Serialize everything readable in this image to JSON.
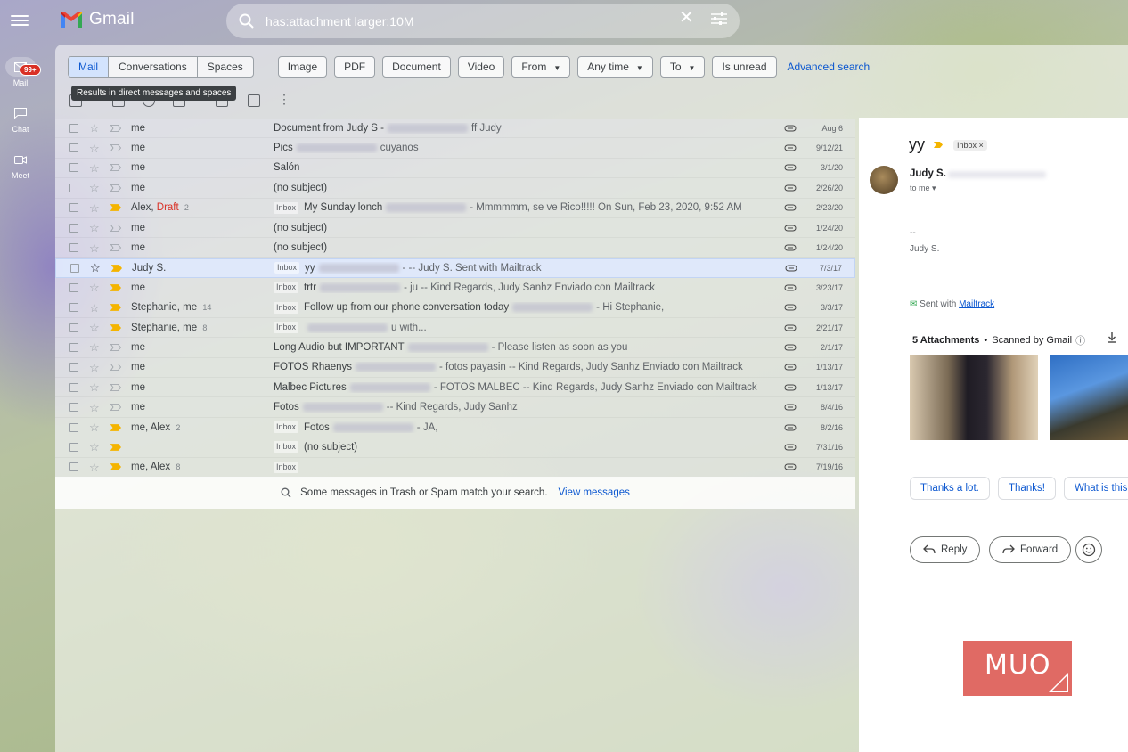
{
  "app": {
    "name": "Gmail"
  },
  "search": {
    "value": "has:attachment larger:10M"
  },
  "rail": {
    "mail_label": "Mail",
    "mail_badge": "99+",
    "chat_label": "Chat",
    "meet_label": "Meet"
  },
  "filters": {
    "scope": [
      "Mail",
      "Conversations",
      "Spaces"
    ],
    "tooltip": "Results in direct messages and spaces",
    "chips": {
      "image": "Image",
      "pdf": "PDF",
      "document": "Document",
      "video": "Video",
      "from": "From",
      "any_time": "Any time",
      "to": "To",
      "is_unread": "Is unread"
    },
    "advanced": "Advanced search"
  },
  "emails": [
    {
      "sender": "me",
      "draft": "",
      "count": "",
      "label": "",
      "subject": "Document from Judy S -",
      "snippet": "ff Judy",
      "date": "Aug 6"
    },
    {
      "sender": "me",
      "draft": "",
      "count": "",
      "label": "",
      "subject": "Pics",
      "snippet": "cuyanos",
      "date": "9/12/21"
    },
    {
      "sender": "me",
      "draft": "",
      "count": "",
      "label": "",
      "subject": "Salón",
      "snippet": "",
      "date": "3/1/20"
    },
    {
      "sender": "me",
      "draft": "",
      "count": "",
      "label": "",
      "subject": "(no subject)",
      "snippet": "",
      "date": "2/26/20"
    },
    {
      "sender": "Alex,",
      "draft": "Draft",
      "count": "2",
      "label": "Inbox",
      "subject": "My Sunday lonch",
      "snippet": "- Mmmmmm, se ve Rico!!!!! On Sun, Feb 23, 2020, 9:52 AM",
      "date": "2/23/20"
    },
    {
      "sender": "me",
      "draft": "",
      "count": "",
      "label": "",
      "subject": "(no subject)",
      "snippet": "",
      "date": "1/24/20"
    },
    {
      "sender": "me",
      "draft": "",
      "count": "",
      "label": "",
      "subject": "(no subject)",
      "snippet": "",
      "date": "1/24/20"
    },
    {
      "sender": "Judy S.",
      "draft": "",
      "count": "",
      "label": "Inbox",
      "subject": "yy",
      "snippet": "- -- Judy S. Sent with Mailtrack",
      "date": "7/3/17"
    },
    {
      "sender": "me",
      "draft": "",
      "count": "",
      "label": "Inbox",
      "subject": "trtr",
      "snippet": "- ju -- Kind Regards, Judy Sanhz Enviado con Mailtrack",
      "date": "3/23/17"
    },
    {
      "sender": "Stephanie, me",
      "draft": "",
      "count": "14",
      "label": "Inbox",
      "subject": "Follow up from our phone conversation today",
      "snippet": "- Hi Stephanie,",
      "date": "3/3/17"
    },
    {
      "sender": "Stephanie, me",
      "draft": "",
      "count": "8",
      "label": "Inbox",
      "subject": "",
      "snippet": "u with...",
      "date": "2/21/17"
    },
    {
      "sender": "me",
      "draft": "",
      "count": "",
      "label": "",
      "subject": "Long Audio but IMPORTANT",
      "snippet": "- Please listen as soon as you",
      "date": "2/1/17"
    },
    {
      "sender": "me",
      "draft": "",
      "count": "",
      "label": "",
      "subject": "FOTOS Rhaenys",
      "snippet": "- fotos payasin -- Kind Regards, Judy Sanhz Enviado con Mailtrack",
      "date": "1/13/17"
    },
    {
      "sender": "me",
      "draft": "",
      "count": "",
      "label": "",
      "subject": "Malbec Pictures",
      "snippet": "- FOTOS MALBEC -- Kind Regards, Judy Sanhz Enviado con Mailtrack",
      "date": "1/13/17"
    },
    {
      "sender": "me",
      "draft": "",
      "count": "",
      "label": "",
      "subject": "Fotos",
      "snippet": "-- Kind Regards, Judy Sanhz",
      "date": "8/4/16"
    },
    {
      "sender": "me, Alex",
      "draft": "",
      "count": "2",
      "label": "Inbox",
      "subject": "Fotos",
      "snippet": "- JA,",
      "date": "8/2/16"
    },
    {
      "sender": "",
      "draft": "",
      "count": "",
      "label": "Inbox",
      "subject": "(no subject)",
      "snippet": "",
      "date": "7/31/16"
    },
    {
      "sender": "me, Alex",
      "draft": "",
      "count": "8",
      "label": "Inbox",
      "subject": "",
      "snippet": "",
      "date": "7/19/16"
    }
  ],
  "trash_note": {
    "text": "Some messages in Trash or Spam match your search.",
    "link": "View messages"
  },
  "reading_pane": {
    "subject": "yy",
    "label": "Inbox",
    "from_name": "Judy S.",
    "to": "to me",
    "body_dash": "--",
    "body_signature": "Judy S.",
    "sent_with": "Sent with",
    "mailtrack": "Mailtrack",
    "attachments_count": "5 Attachments",
    "scanned": "Scanned by Gmail",
    "smart_replies": [
      "Thanks a lot.",
      "Thanks!",
      "What is this"
    ],
    "reply": "Reply",
    "forward": "Forward"
  },
  "watermark": "MUO",
  "colors": {
    "accent": "#0b57d0",
    "important": "#f4b400",
    "draft": "#d93025",
    "badge": "#d93025"
  }
}
